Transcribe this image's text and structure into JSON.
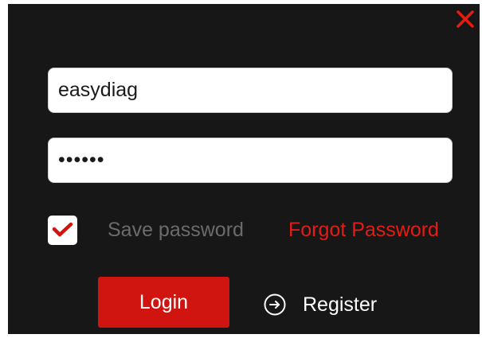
{
  "form": {
    "username_value": "easydiag",
    "password_value": "••••••",
    "save_password_checked": true,
    "save_password_label": "Save password",
    "forgot_password_label": "Forgot Password",
    "login_label": "Login",
    "register_label": "Register"
  },
  "icons": {
    "close": "close-icon",
    "checkmark": "checkmark-icon",
    "register": "arrow-right-circle-icon"
  },
  "colors": {
    "background": "#171717",
    "accent": "#d0140f",
    "link": "#e51b14",
    "muted_text": "#6b6b6b"
  }
}
